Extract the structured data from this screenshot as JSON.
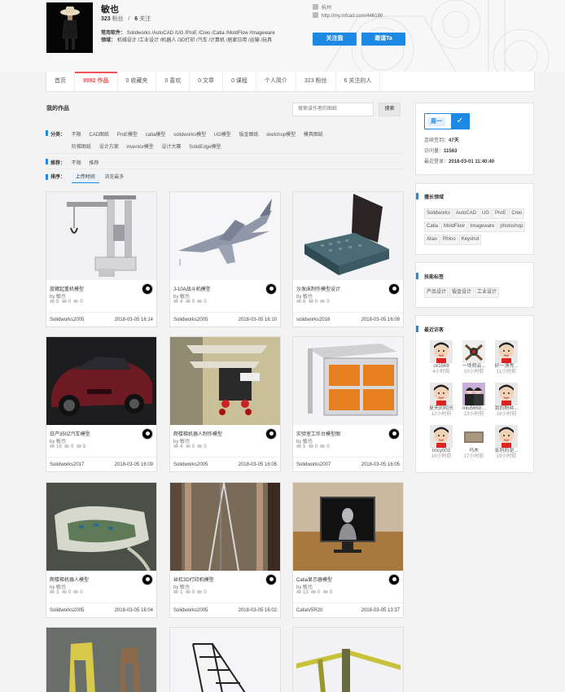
{
  "header": {
    "name": "敏也",
    "fans_count": "323",
    "fans_label": "粉丝",
    "divider": "/",
    "follows_count": "6",
    "follows_label": "关注",
    "software_label": "常用软件：",
    "software": "Solidworks /AutoCAD /UG /ProE /Creo /Catia /MoldFlow /Imageware",
    "field_label": "领域：",
    "fields": "机械设计 /工业设计 /机器人 /3D打印 /汽车 /计算机 /居家日用 /运输 /玩具",
    "location": "杭州",
    "url": "http://my.mfcad.com/446190",
    "follow_btn": "关注我",
    "message_btn": "邀请Ta"
  },
  "nav": {
    "tabs": [
      {
        "label": "首页",
        "active": false
      },
      {
        "label": "9992 作品",
        "active": true
      },
      {
        "label": "0 收藏夹",
        "active": false
      },
      {
        "label": "0 喜欢",
        "active": false
      },
      {
        "label": "0 文章",
        "active": false
      },
      {
        "label": "0 课程",
        "active": false
      },
      {
        "label": "个人简介",
        "active": false
      },
      {
        "label": "323 粉丝",
        "active": false
      },
      {
        "label": "6 关注的人",
        "active": false
      }
    ]
  },
  "works": {
    "title": "我的作品",
    "search_placeholder": "搜索该作者的图纸",
    "search_btn": "搜索",
    "filter_category_label": "分类：",
    "categories_row1": [
      "不限",
      "CAD图纸",
      "ProE模型",
      "catia模型",
      "solidworks模型",
      "UG模型",
      "钣金图纸",
      "sketchup模型",
      "模具图纸"
    ],
    "categories_row2": [
      "阶梯图纸",
      "设计方案",
      "inventor模型",
      "设计大赛",
      "SolidEdge模型"
    ],
    "filter_recommend_label": "推荐：",
    "recommend_opts": [
      "不限",
      "推荐"
    ],
    "filter_sort_label": "排序：",
    "sort_opts": [
      "上传时间",
      "浏览最多"
    ]
  },
  "cards": [
    {
      "title": "旋臂起重机模型",
      "by": "by 敏也",
      "views": "5",
      "likes": "0",
      "comments": "0",
      "software": "Solidworks2005",
      "date": "2018-03-05 16:14"
    },
    {
      "title": "J-10A战斗机模型",
      "by": "by 敏也",
      "views": "4",
      "likes": "0",
      "comments": "0",
      "software": "Solidworks2005",
      "date": "2018-03-05 16:10"
    },
    {
      "title": "沙发床制作模型设计",
      "by": "by 敏也",
      "views": "6",
      "likes": "0",
      "comments": "0",
      "software": "solidworks2016",
      "date": "2018-03-05 16:09"
    },
    {
      "title": "日产350Z汽车模型",
      "by": "by 敏也",
      "views": "16",
      "likes": "0",
      "comments": "5",
      "software": "Solidworks2017",
      "date": "2018-03-05 16:09"
    },
    {
      "title": "爬楼梯机器人制作模型",
      "by": "by 敏也",
      "views": "4",
      "likes": "0",
      "comments": "0",
      "software": "Solidworks2005",
      "date": "2018-03-05 16:05"
    },
    {
      "title": "实验室工作台模型图",
      "by": "by 敏也",
      "views": "5",
      "likes": "0",
      "comments": "0",
      "software": "Solidworks2007",
      "date": "2018-03-05 16:05"
    },
    {
      "title": "爬楼梯机器人模型",
      "by": "by 敏也",
      "views": "3",
      "likes": "0",
      "comments": "0",
      "software": "Solidworks2005",
      "date": "2018-03-05 16:04"
    },
    {
      "title": "丝杠3D打印机模型",
      "by": "by 敏也",
      "views": "1",
      "likes": "0",
      "comments": "0",
      "software": "Solidworks2005",
      "date": "2018-03-05 16:02"
    },
    {
      "title": "Catia显示器模型",
      "by": "by 敏也",
      "views": "13",
      "likes": "0",
      "comments": "0",
      "software": "CatiaV5R20",
      "date": "2018-03-05 13:37"
    }
  ],
  "sidebar": {
    "badge_day": "周一",
    "stats": [
      {
        "label": "连续签到：",
        "value": "47天"
      },
      {
        "label": "访问量：",
        "value": "11563"
      },
      {
        "label": "最近登录：",
        "value": "2018-03-01 11:40:40"
      }
    ],
    "skills_title": "擅长领域",
    "skills": [
      "Solidworks",
      "AutoCAD",
      "UG",
      "ProE",
      "Creo",
      "Catia",
      "MoldFlow",
      "Imageware",
      "photoshop",
      "Alias",
      "Rhino",
      "Keyshot"
    ],
    "abilities_title": "技能标签",
    "abilities": [
      "产品设计",
      "钣金设计",
      "工业设计"
    ],
    "visitors_title": "最近访客",
    "visitors": [
      {
        "name": "ck1569",
        "time": "4小时前"
      },
      {
        "name": "一场阴云...",
        "time": "10小时前"
      },
      {
        "name": "好一漂亮...",
        "time": "11小时前"
      },
      {
        "name": "夏天的阳光",
        "time": "12小时前"
      },
      {
        "name": "mlu5669...",
        "time": "13小时前"
      },
      {
        "name": "我的粉丝...",
        "time": "16小时前"
      },
      {
        "name": "lincy003",
        "time": "16小时前"
      },
      {
        "name": "乌木",
        "time": "17小时前"
      },
      {
        "name": "张利的是...",
        "time": "19小时前"
      }
    ]
  }
}
